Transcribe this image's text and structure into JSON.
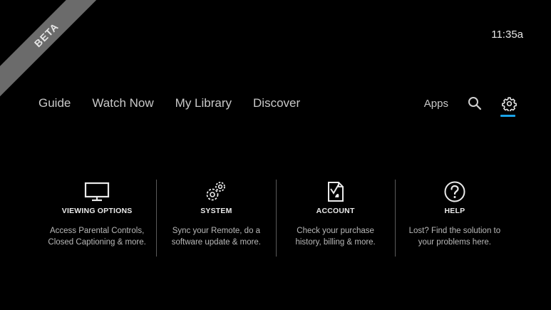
{
  "badge": {
    "label": "BETA"
  },
  "clock": {
    "time": "11:35a"
  },
  "nav": {
    "items": [
      {
        "label": "Guide"
      },
      {
        "label": "Watch Now"
      },
      {
        "label": "My Library"
      },
      {
        "label": "Discover"
      }
    ],
    "apps_label": "Apps",
    "search_icon": "search-icon",
    "settings_icon": "gear-icon",
    "accent_color": "#1aa3e8"
  },
  "settings": {
    "panels": [
      {
        "title": "VIEWING OPTIONS",
        "desc_line1": "Access Parental Controls,",
        "desc_line2": "Closed Captioning & more.",
        "icon": "monitor-icon"
      },
      {
        "title": "SYSTEM",
        "desc_line1": "Sync your Remote, do a",
        "desc_line2": "software update & more.",
        "icon": "gears-icon"
      },
      {
        "title": "ACCOUNT",
        "desc_line1": "Check your purchase",
        "desc_line2": "history, billing & more.",
        "icon": "document-icon"
      },
      {
        "title": "HELP",
        "desc_line1": "Lost? Find the solution to",
        "desc_line2": "your problems here.",
        "icon": "question-icon"
      }
    ]
  }
}
